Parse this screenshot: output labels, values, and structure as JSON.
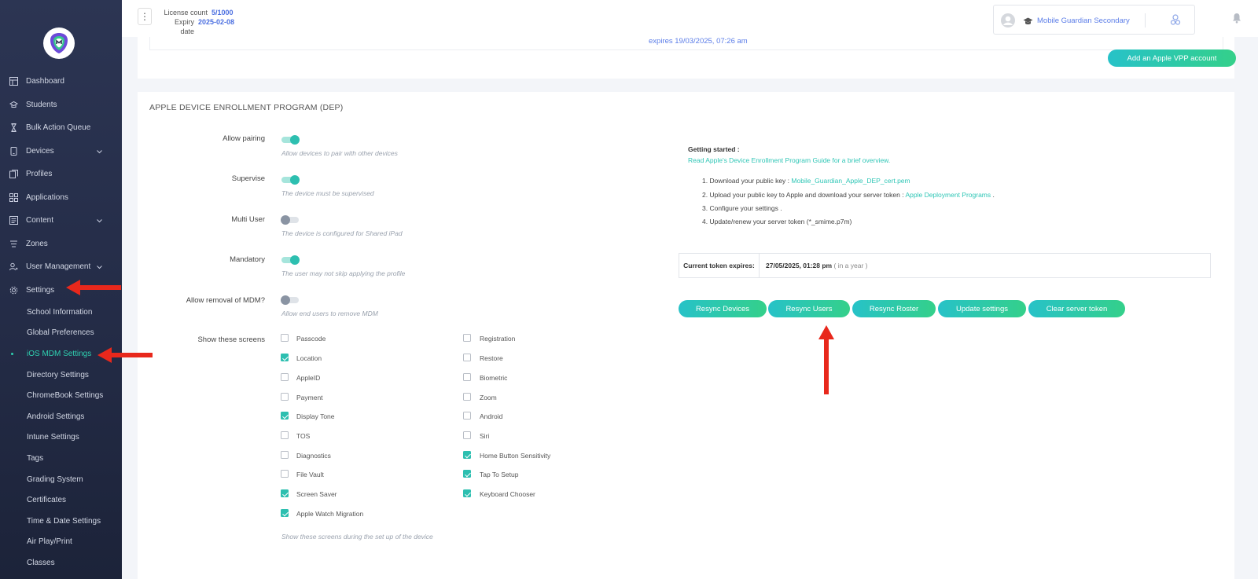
{
  "sidebar": {
    "items": [
      {
        "label": "Dashboard",
        "icon": "dashboard-icon"
      },
      {
        "label": "Students",
        "icon": "students-icon"
      },
      {
        "label": "Bulk Action Queue",
        "icon": "hourglass-icon"
      },
      {
        "label": "Devices",
        "icon": "device-icon"
      },
      {
        "label": "Profiles",
        "icon": "profiles-icon"
      },
      {
        "label": "Applications",
        "icon": "apps-icon"
      },
      {
        "label": "Content",
        "icon": "content-icon"
      },
      {
        "label": "Zones",
        "icon": "zones-icon"
      },
      {
        "label": "User Management",
        "icon": "users-icon"
      },
      {
        "label": "Settings",
        "icon": "gear-icon"
      }
    ],
    "settings_sub": [
      "School Information",
      "Global Preferences",
      "iOS MDM Settings",
      "Directory Settings",
      "ChromeBook Settings",
      "Android Settings",
      "Intune Settings",
      "Tags",
      "Grading System",
      "Certificates",
      "Time & Date Settings",
      "Air Play/Print",
      "Classes"
    ]
  },
  "topbar": {
    "license_label": "License count",
    "license_value": "5/1000",
    "expiry_label": "Expiry date",
    "expiry_value": "2025-02-08",
    "school_name": "Mobile Guardian Secondary"
  },
  "vpp": {
    "expires_text": "expires 19/03/2025, 07:26 am",
    "add_button": "Add an Apple VPP account"
  },
  "dep": {
    "title": "APPLE DEVICE ENROLLMENT PROGRAM (DEP)",
    "settings": [
      {
        "label": "Allow pairing",
        "hint": "Allow devices to pair with other devices",
        "on": true
      },
      {
        "label": "Supervise",
        "hint": "The device must be supervised",
        "on": true
      },
      {
        "label": "Multi User",
        "hint": "The device is configured for Shared iPad",
        "on": false
      },
      {
        "label": "Mandatory",
        "hint": "The user may not skip applying the profile",
        "on": true
      },
      {
        "label": "Allow removal of MDM?",
        "hint": "Allow end users to remove MDM",
        "on": false
      }
    ],
    "screens_label": "Show these screens",
    "screens_hint": "Show these screens during the set up of the device",
    "screens_left": [
      {
        "label": "Passcode",
        "checked": false
      },
      {
        "label": "Location",
        "checked": true
      },
      {
        "label": "AppleID",
        "checked": false
      },
      {
        "label": "Payment",
        "checked": false
      },
      {
        "label": "Display Tone",
        "checked": true
      },
      {
        "label": "TOS",
        "checked": false
      },
      {
        "label": "Diagnostics",
        "checked": false
      },
      {
        "label": "File Vault",
        "checked": false
      },
      {
        "label": "Screen Saver",
        "checked": true
      },
      {
        "label": "Apple Watch Migration",
        "checked": true
      }
    ],
    "screens_right": [
      {
        "label": "Registration",
        "checked": false
      },
      {
        "label": "Restore",
        "checked": false
      },
      {
        "label": "Biometric",
        "checked": false
      },
      {
        "label": "Zoom",
        "checked": false
      },
      {
        "label": "Android",
        "checked": false
      },
      {
        "label": "Siri",
        "checked": false
      },
      {
        "label": "Home Button Sensitivity",
        "checked": true
      },
      {
        "label": "Tap To Setup",
        "checked": true
      },
      {
        "label": "Keyboard Chooser",
        "checked": true
      }
    ],
    "guide": {
      "heading": "Getting started :",
      "read_guide": "Read Apple's Device Enrollment Program Guide for a brief overview.",
      "step1_text": "1. Download your public key : ",
      "step1_link": "Mobile_Guardian_Apple_DEP_cert.pem",
      "step2_text": "2. Upload your public key to Apple and download your server token : ",
      "step2_link": "Apple Deployment Programs",
      "step2_end": " .",
      "step3": "3. Configure your settings .",
      "step4": "4. Update/renew your server token (*_smime.p7m)"
    },
    "token": {
      "label": "Current token expires:",
      "value": "27/05/2025, 01:28 pm",
      "relative": "( in a year )"
    },
    "buttons": {
      "resync_devices": "Resync Devices",
      "resync_users": "Resync Users",
      "resync_roster": "Resync Roster",
      "update_settings": "Update settings",
      "clear_token": "Clear server token"
    }
  },
  "colors": {
    "accent": "#2dbfb0",
    "sidebar_bg": "#242c47",
    "link_blue": "#5b7de8",
    "annotation_red": "#e8281c"
  }
}
